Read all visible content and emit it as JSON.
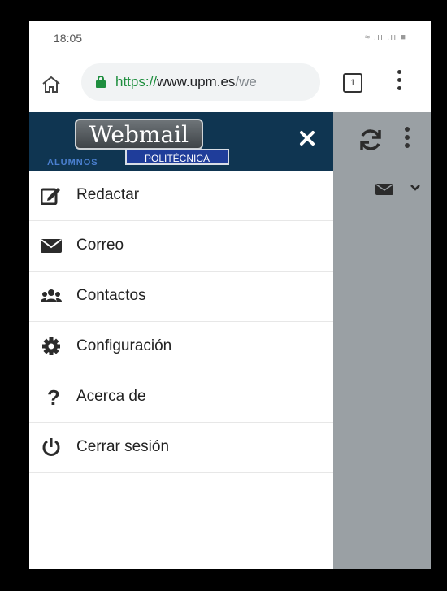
{
  "status_bar": {
    "time": "18:05",
    "icons": "≈ .ıı .ıı ■"
  },
  "browser": {
    "url_scheme": "https://",
    "url_host": "www.upm.es",
    "url_path": "/we",
    "tab_count": "1"
  },
  "app": {
    "logo_text": "Webmail",
    "logo_sub": "ALUMNOS",
    "logo_badge": "POLITÉCNICA"
  },
  "menu": {
    "items": [
      {
        "label": "Redactar",
        "icon": "compose-icon"
      },
      {
        "label": "Correo",
        "icon": "envelope-icon"
      },
      {
        "label": "Contactos",
        "icon": "users-icon"
      },
      {
        "label": "Configuración",
        "icon": "gear-icon"
      },
      {
        "label": "Acerca de",
        "icon": "question-icon"
      },
      {
        "label": "Cerrar sesión",
        "icon": "power-icon"
      }
    ]
  },
  "colors": {
    "drawer_header": "#0f3551",
    "overlay": "#9aa0a4",
    "url_scheme": "#1e8e3e"
  }
}
